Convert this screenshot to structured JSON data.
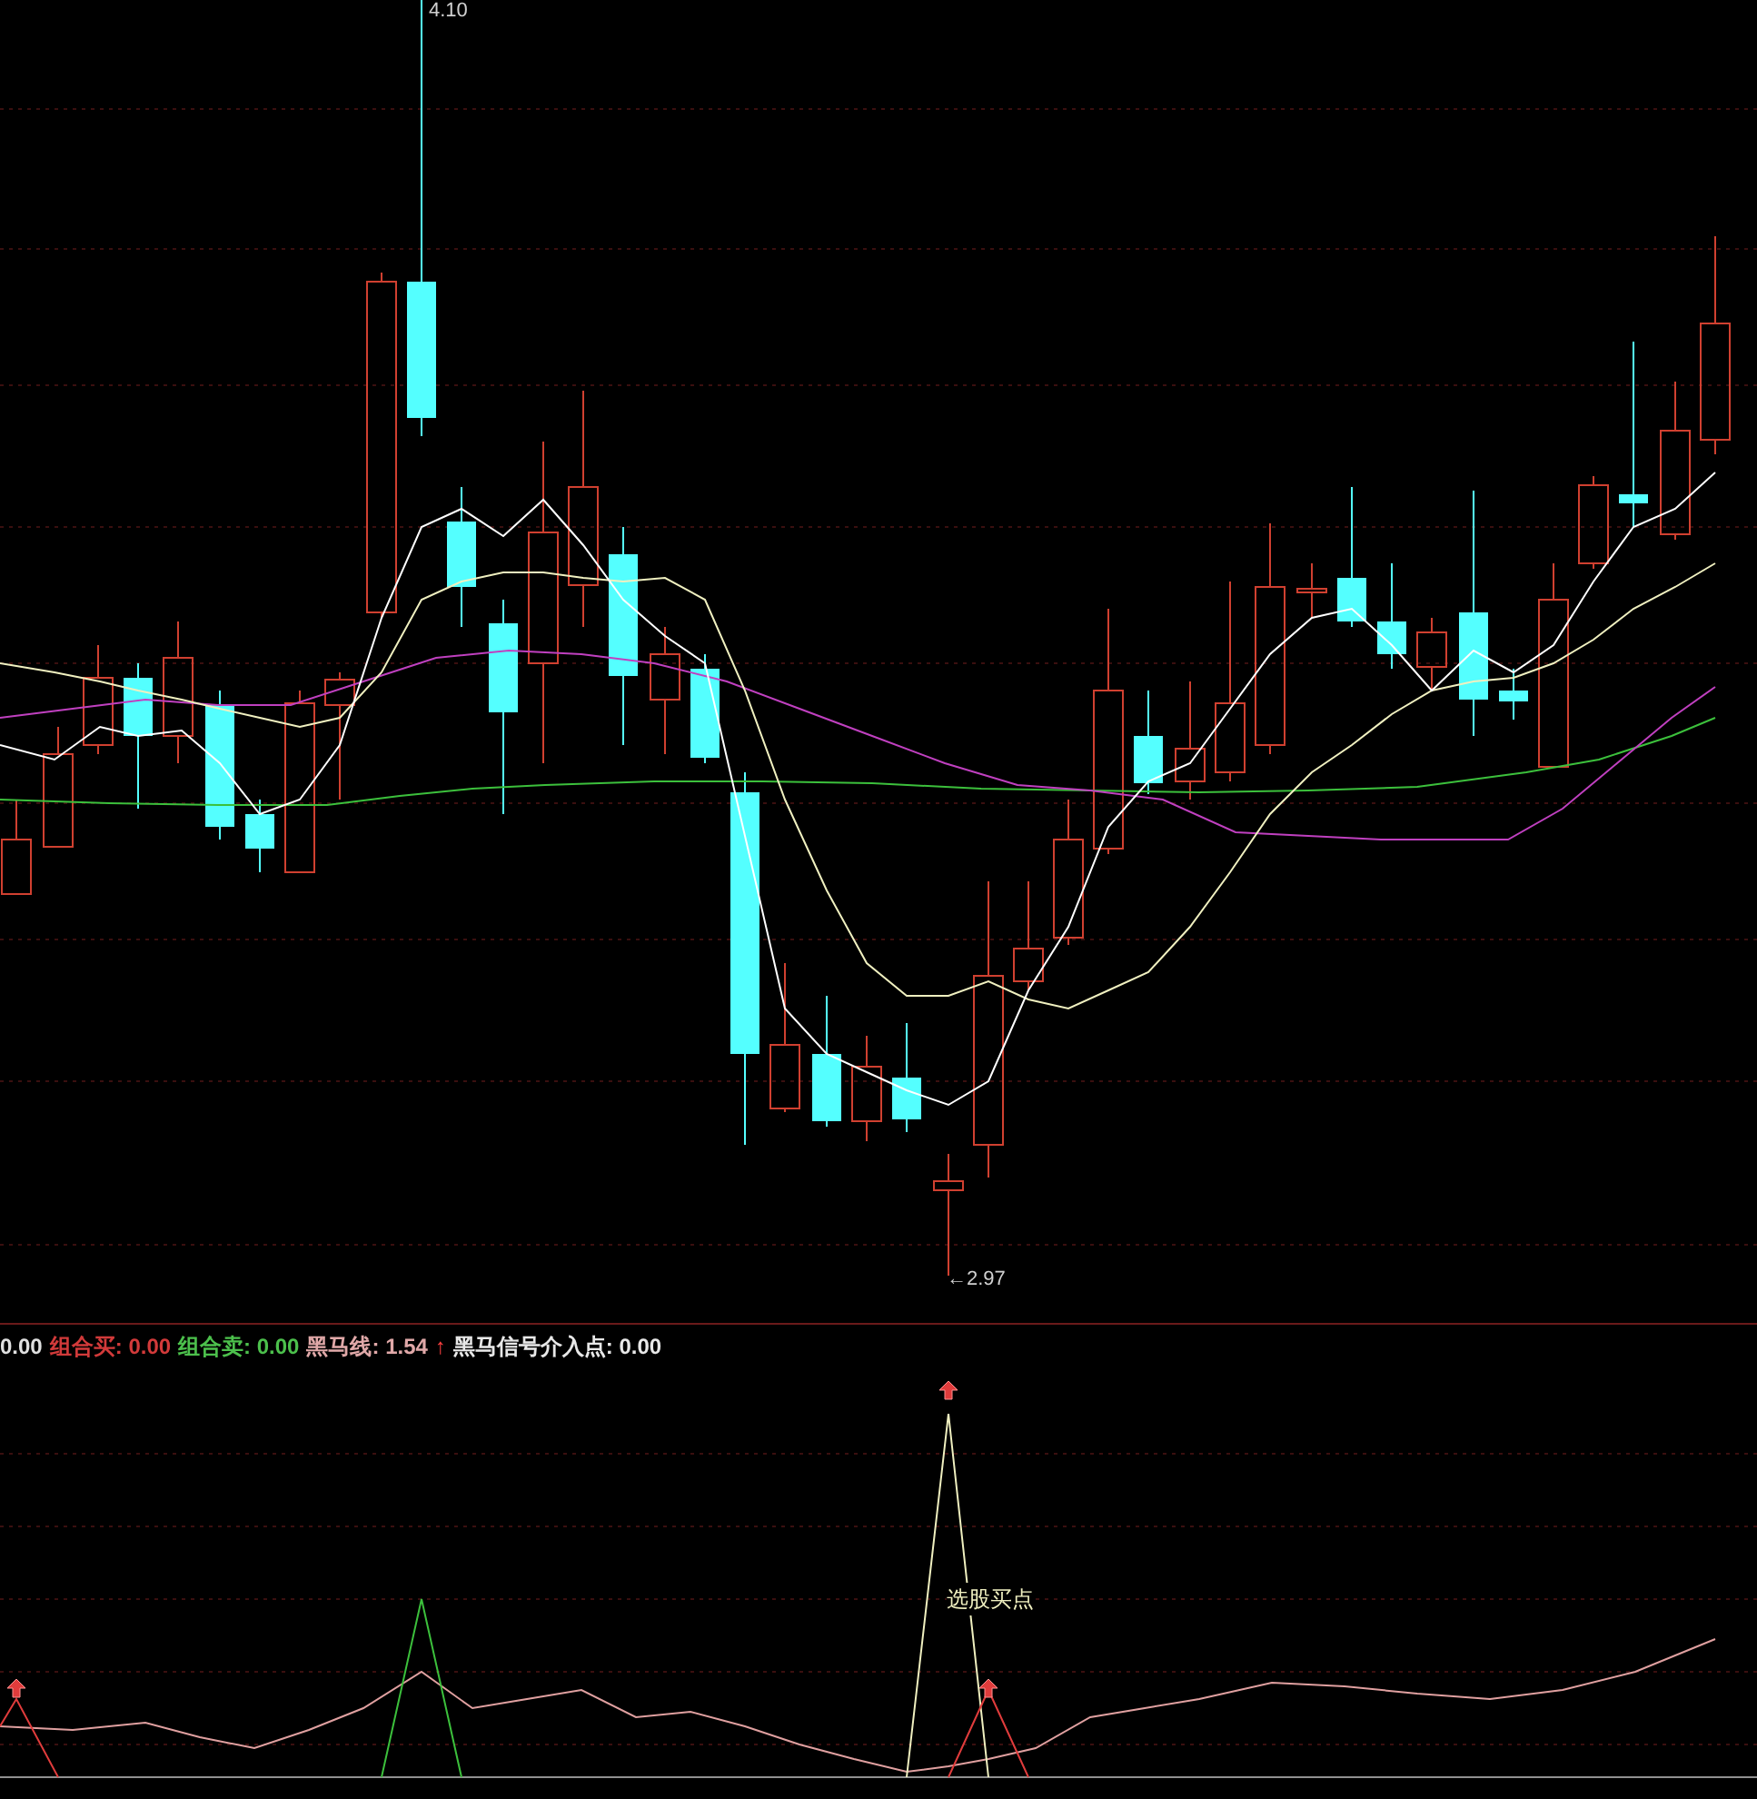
{
  "price_chart": {
    "high_label": "4.10",
    "low_label": "←2.97"
  },
  "indicator_legend": [
    {
      "text": "0.00",
      "color": "#e0e0e0"
    },
    {
      "text": "组合买: 0.00",
      "color": "#d23a3a"
    },
    {
      "text": "组合卖: 0.00",
      "color": "#4cc04c"
    },
    {
      "text": "黑马线: 1.54",
      "color": "#e0a8a8"
    },
    {
      "text": "↑",
      "color": "#ff4040"
    },
    {
      "text": "黑马信号介入点: 0.00",
      "color": "#e8e8e8"
    }
  ],
  "indicator_chart": {
    "signal_label": "选股买点"
  }
}
